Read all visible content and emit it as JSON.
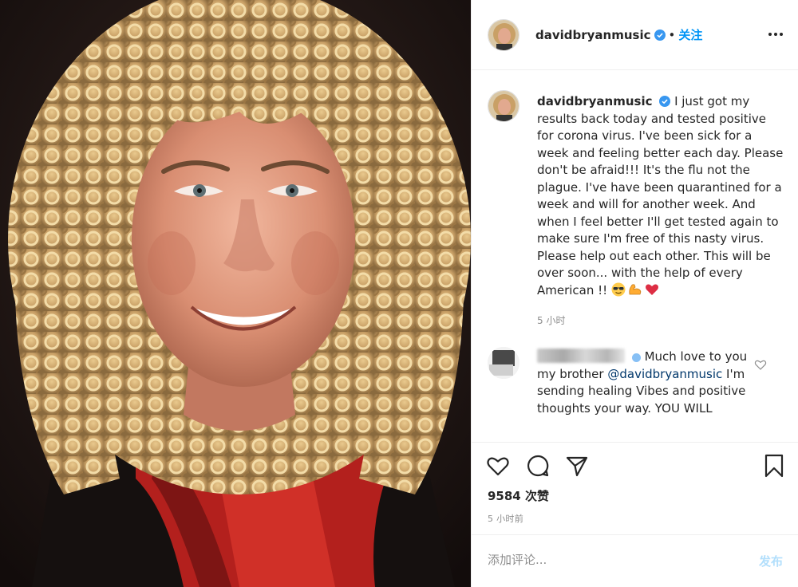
{
  "post": {
    "username": "davidbryanmusic",
    "verified": true,
    "separator": "•",
    "follow_label": "关注",
    "caption_username": "davidbryanmusic",
    "caption_text": "I just got my results back today and tested positive for corona virus. I've been sick for a week and feeling better each day. Please don't be afraid!!! It's the flu not the plague. I've have been quarantined for a week and will for another week. And when I feel better I'll get tested again to make sure I'm free of this nasty virus. Please help out each other. This will be over soon... with the help of every American !!",
    "caption_emojis": [
      "sunglasses-emoji",
      "flexed-bicep-emoji",
      "red-heart-emoji"
    ],
    "caption_time": "5 小时",
    "likes": "9584 次赞",
    "timestamp": "5 小时前"
  },
  "comment": {
    "text_1": "Much love to you my brother",
    "mention": "@davidbryanmusic",
    "text_2": "I'm sending healing Vibes and positive thoughts your way. YOU WILL"
  },
  "composer": {
    "placeholder": "添加评论...",
    "post_label": "发布"
  },
  "colors": {
    "accent": "#0095f6",
    "verified": "#3897f0",
    "post_disabled": "#b2dffc",
    "like_heart": "#ed4956"
  }
}
